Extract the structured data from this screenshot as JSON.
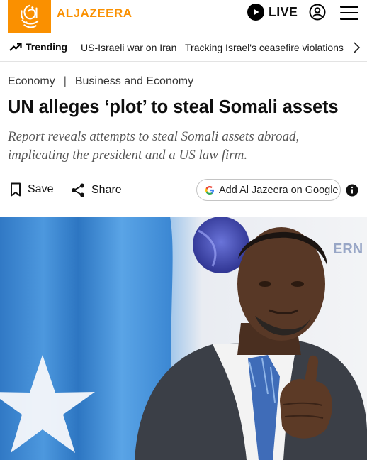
{
  "header": {
    "logo_text": "ALJAZEERA",
    "live_label": "LIVE",
    "brand_color": "#fa9000"
  },
  "trending": {
    "label": "Trending",
    "links": [
      "US-Israeli war on Iran",
      "Tracking Israel's ceasefire violations"
    ]
  },
  "article": {
    "breadcrumbs": [
      "Economy",
      "Business and Economy"
    ],
    "breadcrumb_separator": "|",
    "headline": "UN alleges ‘plot’ to steal Somali assets",
    "subheading": "Report reveals attempts to steal Somali assets abroad, implicating the president and a US law firm.",
    "actions": {
      "save_label": "Save",
      "share_label": "Share",
      "google_label": "Add Al Jazeera on Google"
    }
  },
  "hero_image": {
    "backdrop_text": "ERN",
    "flag_color": "#3e8fd6"
  },
  "icons": [
    "play-icon",
    "account-icon",
    "menu-icon",
    "trending-arrow-icon",
    "chevron-right-icon",
    "bookmark-icon",
    "share-icon",
    "google-g-icon",
    "info-icon"
  ]
}
